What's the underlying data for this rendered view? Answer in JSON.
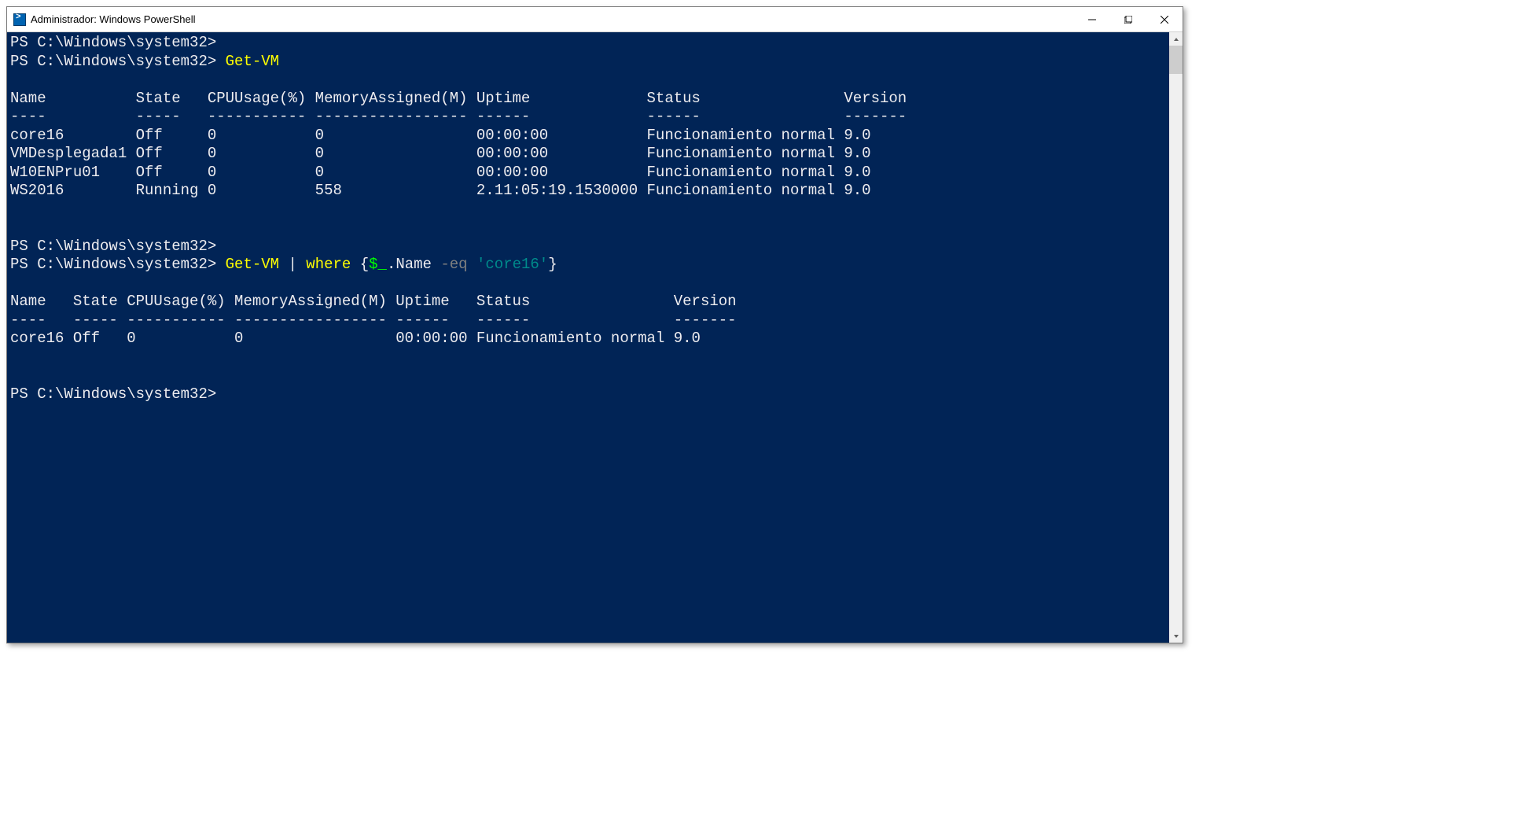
{
  "window": {
    "title": "Administrador: Windows PowerShell"
  },
  "terminal": {
    "prompt": "PS C:\\Windows\\system32>",
    "cmd1": {
      "command": "Get-VM"
    },
    "table1": {
      "headers": {
        "name": "Name",
        "state": "State",
        "cpu": "CPUUsage(%)",
        "mem": "MemoryAssigned(M)",
        "uptime": "Uptime",
        "status": "Status",
        "version": "Version"
      },
      "sep": {
        "name": "----",
        "state": "-----",
        "cpu": "-----------",
        "mem": "-----------------",
        "uptime": "------",
        "status": "------",
        "version": "-------"
      },
      "rows": [
        {
          "name": "core16",
          "state": "Off",
          "cpu": "0",
          "mem": "0",
          "uptime": "00:00:00",
          "status": "Funcionamiento normal",
          "version": "9.0"
        },
        {
          "name": "VMDesplegada1",
          "state": "Off",
          "cpu": "0",
          "mem": "0",
          "uptime": "00:00:00",
          "status": "Funcionamiento normal",
          "version": "9.0"
        },
        {
          "name": "W10ENPru01",
          "state": "Off",
          "cpu": "0",
          "mem": "0",
          "uptime": "00:00:00",
          "status": "Funcionamiento normal",
          "version": "9.0"
        },
        {
          "name": "WS2016",
          "state": "Running",
          "cpu": "0",
          "mem": "558",
          "uptime": "2.11:05:19.1530000",
          "status": "Funcionamiento normal",
          "version": "9.0"
        }
      ]
    },
    "cmd2": {
      "command": "Get-VM",
      "pipe": " | ",
      "where": "where",
      "brace_open": " {",
      "dollar": "$_",
      "dotname": ".Name ",
      "eq": "-eq",
      "space": " ",
      "quoted": "'core16'",
      "brace_close": "}"
    },
    "table2": {
      "headers": {
        "name": "Name",
        "state": "State",
        "cpu": "CPUUsage(%)",
        "mem": "MemoryAssigned(M)",
        "uptime": "Uptime",
        "status": "Status",
        "version": "Version"
      },
      "sep": {
        "name": "----",
        "state": "-----",
        "cpu": "-----------",
        "mem": "-----------------",
        "uptime": "------",
        "status": "------",
        "version": "-------"
      },
      "rows": [
        {
          "name": "core16",
          "state": "Off",
          "cpu": "0",
          "mem": "0",
          "uptime": "00:00:00",
          "status": "Funcionamiento normal",
          "version": "9.0"
        }
      ]
    }
  },
  "layout": {
    "table1_cols": {
      "name": 14,
      "state": 8,
      "cpu": 12,
      "mem": 18,
      "uptime": 19,
      "status": 22,
      "version": 7
    },
    "table2_cols": {
      "name": 7,
      "state": 6,
      "cpu": 12,
      "mem": 18,
      "uptime": 9,
      "status": 22,
      "version": 7
    }
  }
}
